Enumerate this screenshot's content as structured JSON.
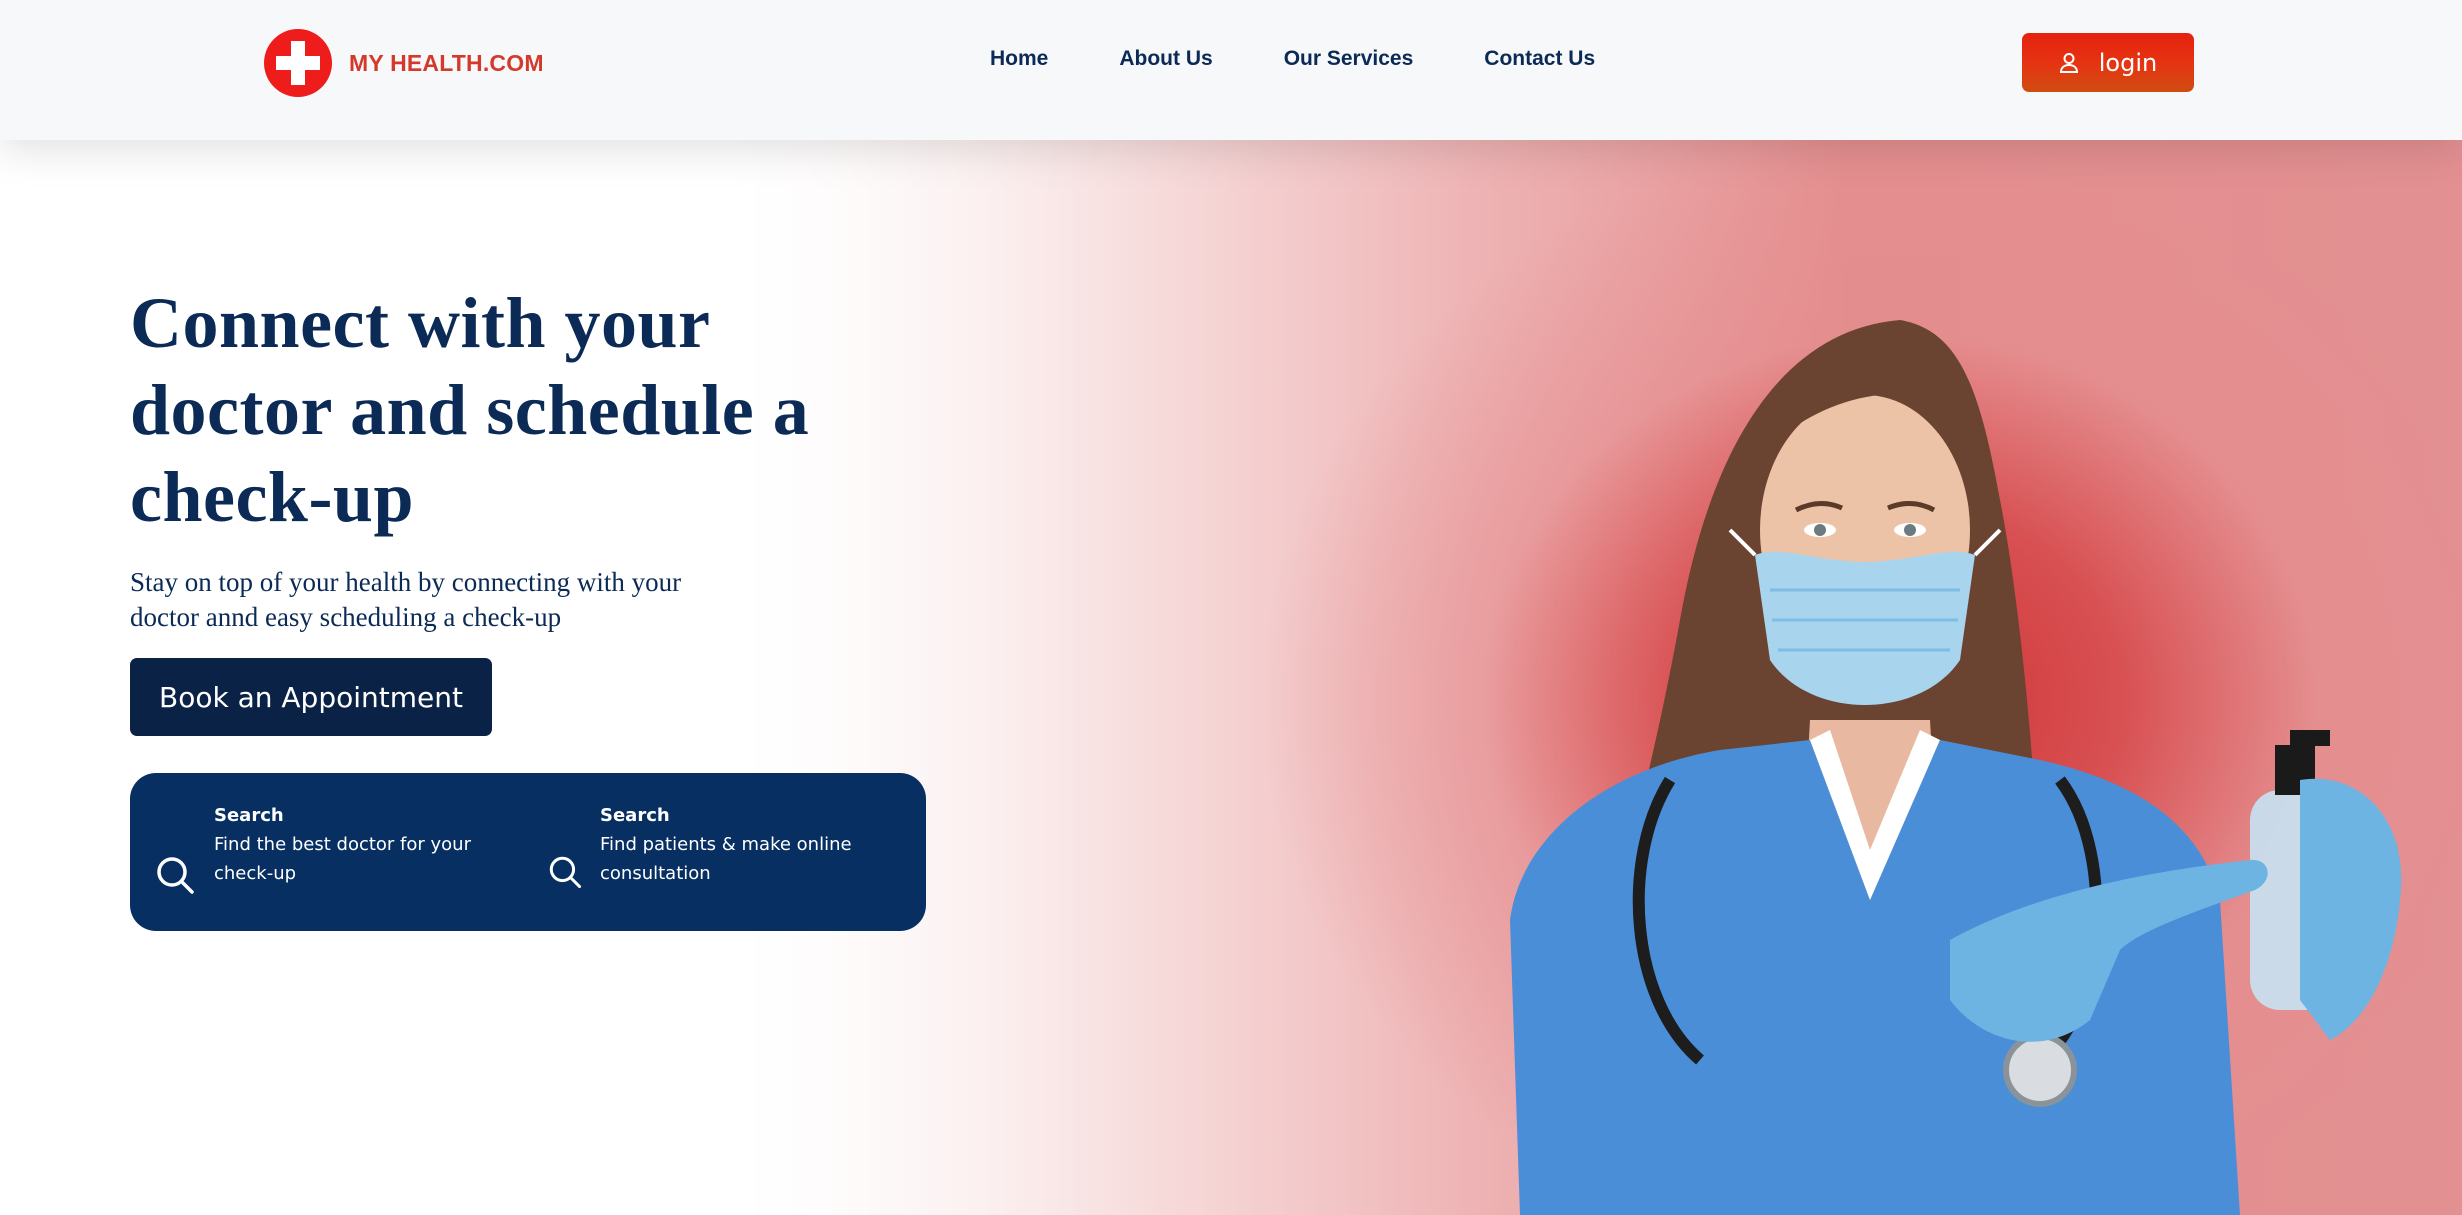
{
  "brand": {
    "name": "MY HEALTH.COM",
    "logo_icon": "medical-cross-icon",
    "logo_color": "#ef1c1c",
    "name_color": "#d33a2c"
  },
  "nav": {
    "items": [
      {
        "label": "Home"
      },
      {
        "label": "About Us"
      },
      {
        "label": "Our Services"
      },
      {
        "label": "Contact Us"
      }
    ]
  },
  "login": {
    "label": "login",
    "icon": "user-icon",
    "color": "#e5280f"
  },
  "hero": {
    "headline": "Connect with your doctor and schedule a check-up",
    "subtitle": "Stay on top of your health by connecting with your doctor annd easy scheduling a check-up",
    "cta_label": "Book an Appointment",
    "primary_color": "#0b2a55",
    "accent_background": "#d94a4c"
  },
  "search_panel": {
    "items": [
      {
        "title": "Search",
        "description": "Find the best doctor for your check-up",
        "icon": "search-icon"
      },
      {
        "title": "Search",
        "description": "Find patients & make online consultation",
        "icon": "search-icon"
      }
    ]
  },
  "hero_image": {
    "subject": "doctor-with-mask-and-sanitizer"
  }
}
